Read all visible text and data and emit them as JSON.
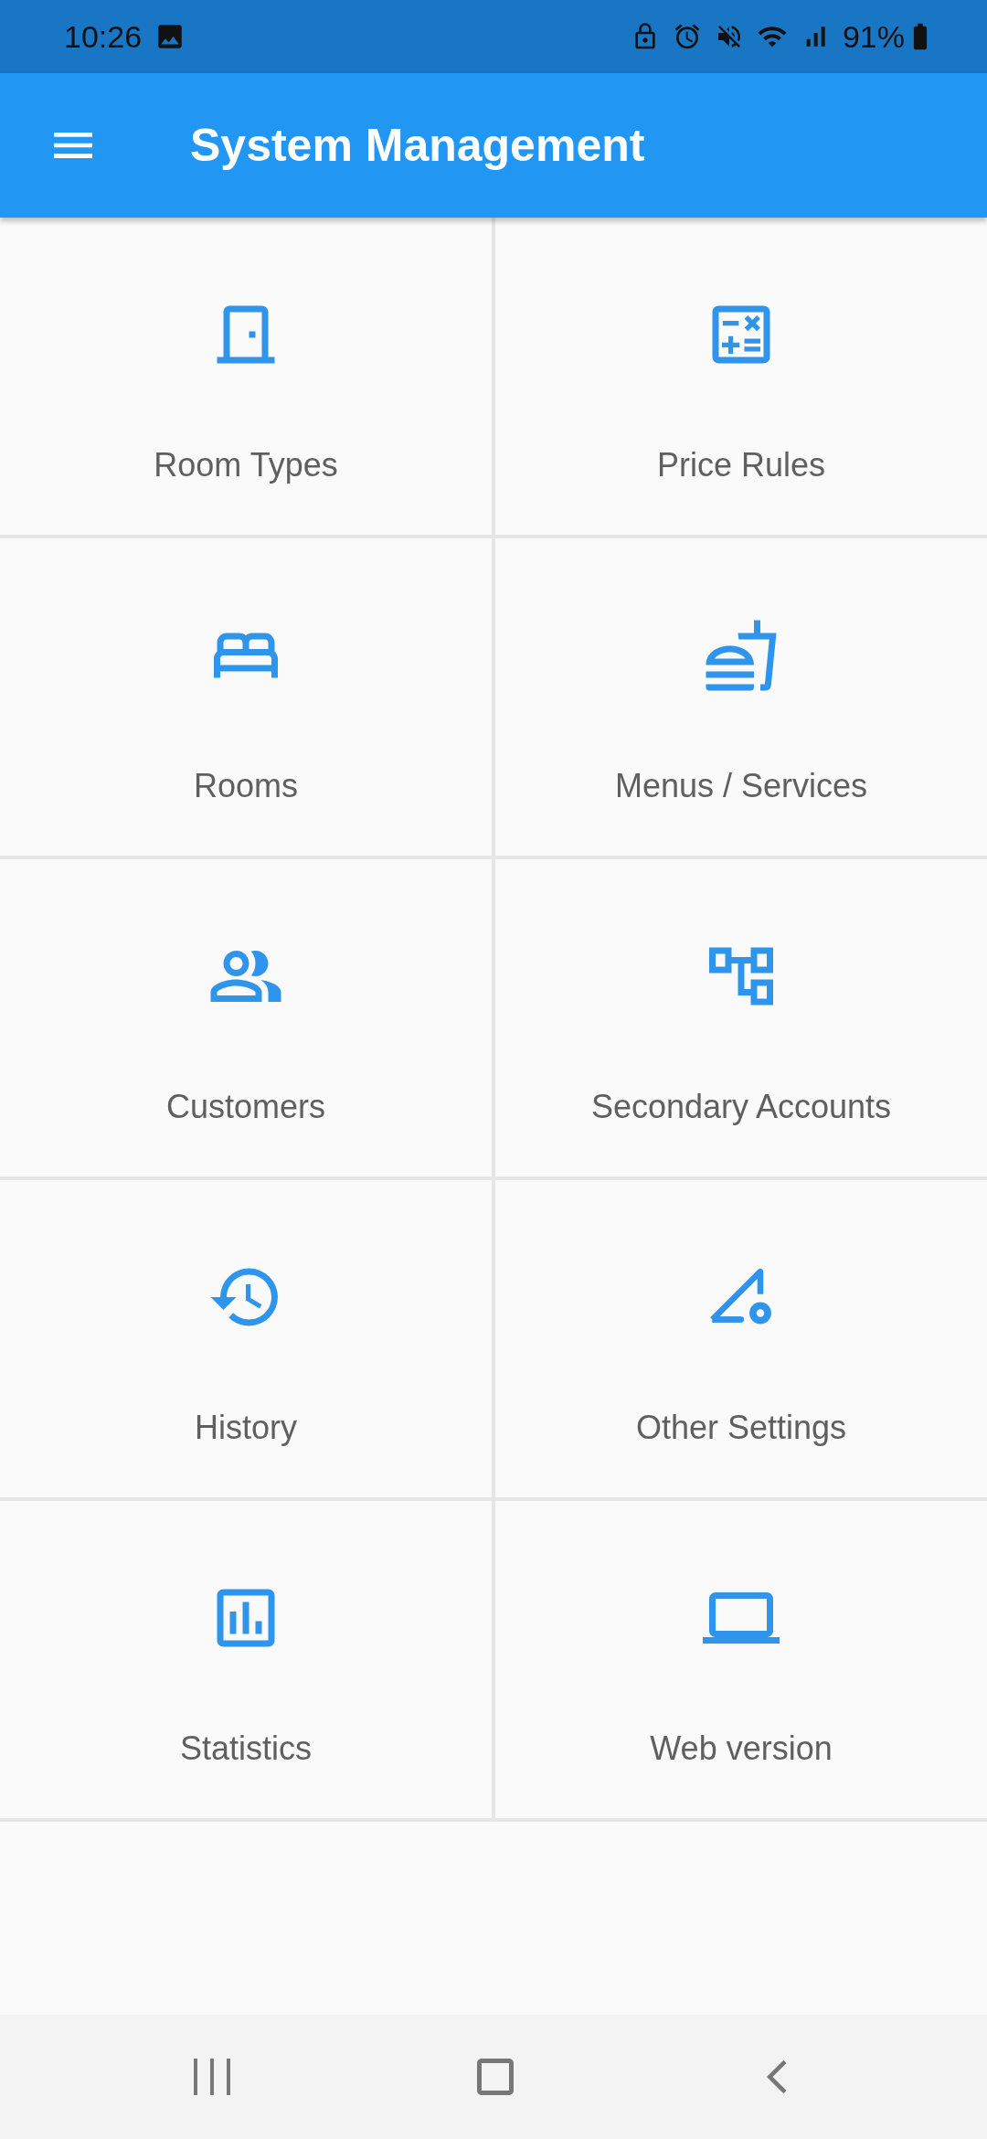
{
  "status_bar": {
    "time": "10:26",
    "battery": "91%"
  },
  "app_bar": {
    "title": "System Management"
  },
  "tiles": [
    {
      "label": "Room Types"
    },
    {
      "label": "Price Rules"
    },
    {
      "label": "Rooms"
    },
    {
      "label": "Menus / Services"
    },
    {
      "label": "Customers"
    },
    {
      "label": "Secondary Accounts"
    },
    {
      "label": "History"
    },
    {
      "label": "Other Settings"
    },
    {
      "label": "Statistics"
    },
    {
      "label": "Web version"
    }
  ]
}
